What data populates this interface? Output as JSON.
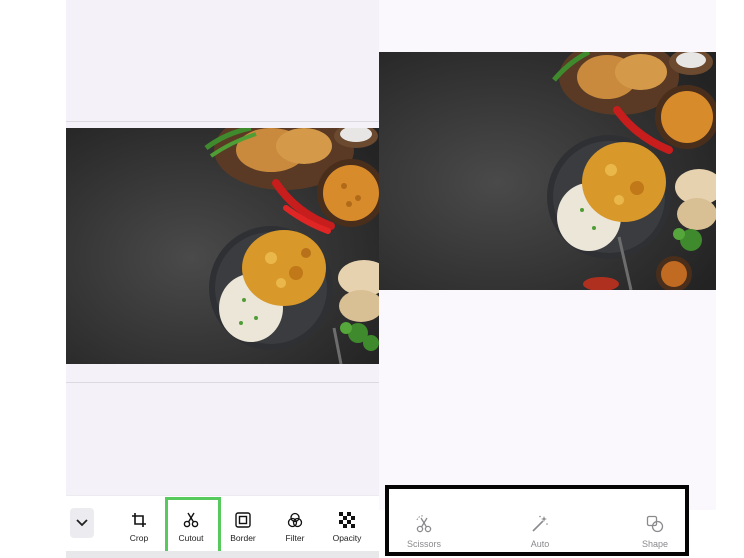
{
  "left_toolbar": {
    "tools": [
      {
        "label": "Crop",
        "icon": "crop-icon"
      },
      {
        "label": "Cutout",
        "icon": "scissors-icon"
      },
      {
        "label": "Border",
        "icon": "border-icon"
      },
      {
        "label": "Filter",
        "icon": "filter-icon"
      },
      {
        "label": "Opacity",
        "icon": "opacity-icon"
      }
    ],
    "collapse_icon": "chevron-down-icon",
    "highlight_color": "#57c95d"
  },
  "right_toolbar": {
    "tools": [
      {
        "label": "Scissors",
        "icon": "scissors-dotted-icon"
      },
      {
        "label": "Auto",
        "icon": "magic-wand-icon"
      },
      {
        "label": "Shape",
        "icon": "shape-icon"
      }
    ],
    "highlight_color": "#050505"
  },
  "photo": {
    "subject": "food-plate-image"
  }
}
